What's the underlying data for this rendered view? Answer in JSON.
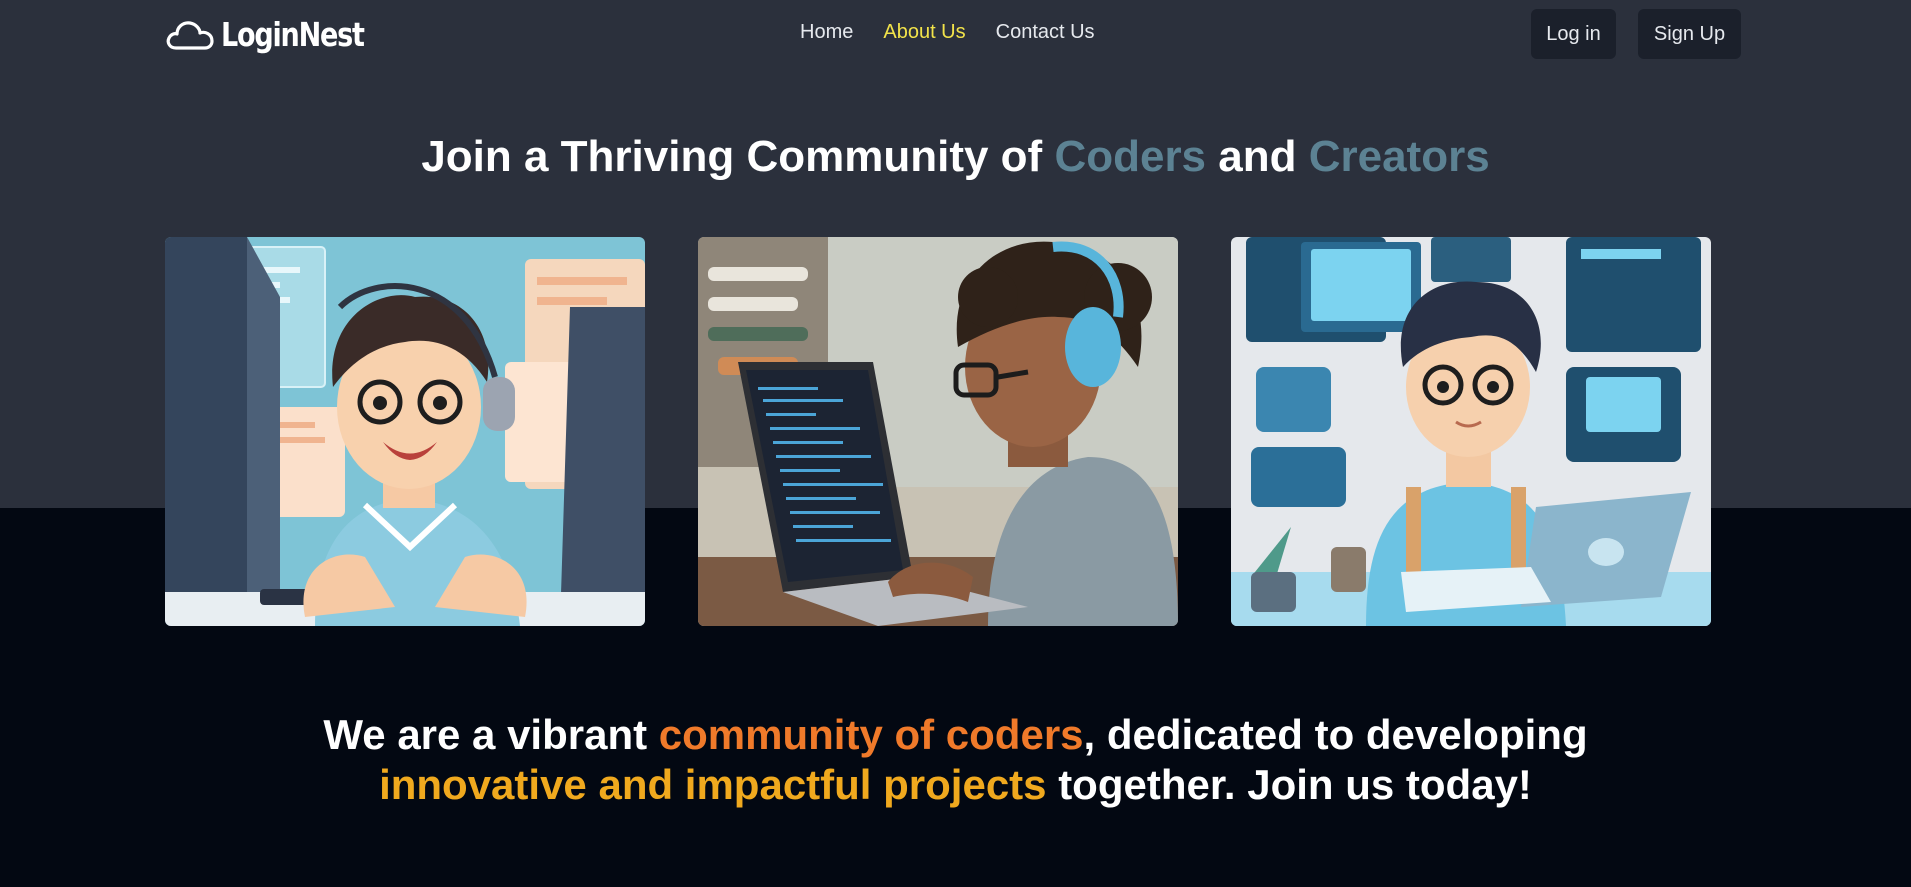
{
  "brand": {
    "name": "LoginNest",
    "icon": "cloud-icon"
  },
  "nav": {
    "links": [
      {
        "label": "Home",
        "active": false
      },
      {
        "label": "About Us",
        "active": true
      },
      {
        "label": "Contact Us",
        "active": false
      }
    ],
    "login_label": "Log in",
    "signup_label": "Sign Up"
  },
  "hero": {
    "title_part1": "Join a Thriving Community of ",
    "title_accent1": "Coders",
    "title_part2": " and ",
    "title_accent2": "Creators"
  },
  "cards": [
    {
      "illustration": "coder-with-headset-at-monitor"
    },
    {
      "illustration": "coder-with-headphones-at-laptop"
    },
    {
      "illustration": "coder-at-laptop-with-screens"
    }
  ],
  "tagline": {
    "part1": "We are a vibrant ",
    "highlight1": "community of coders",
    "part2": ", dedicated to developing",
    "highlight2": "innovative and impactful projects",
    "part3": " together. Join us today!"
  },
  "colors": {
    "header_bg": "#2b303c",
    "page_bg": "#030812",
    "nav_active": "#f2e34a",
    "hero_accent": "#5c8293",
    "tagline_orange": "#f07a2a",
    "tagline_gold": "#f0a91e"
  }
}
